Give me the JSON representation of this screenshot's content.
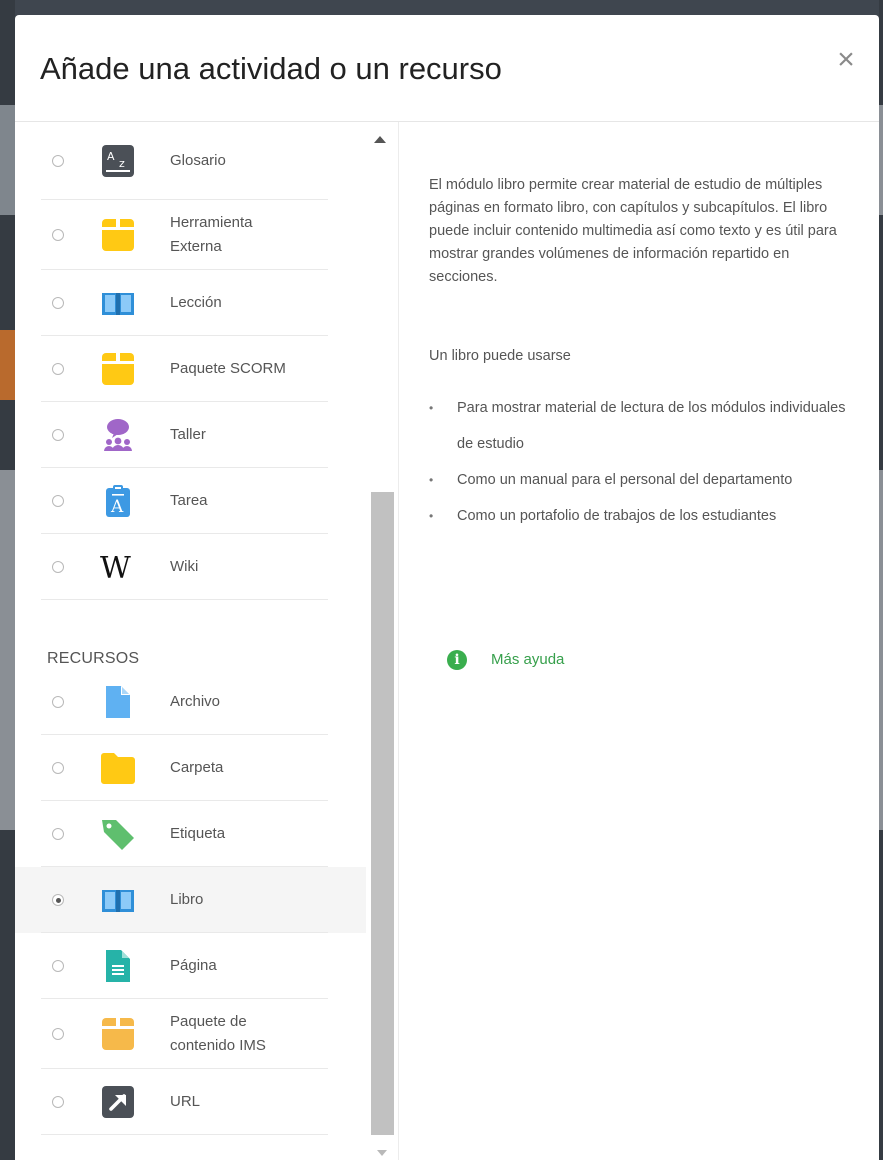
{
  "modal": {
    "title": "Añade una actividad o un recurso",
    "close_label": "×"
  },
  "activities": [
    {
      "label": "Glosario",
      "icon": "glossary-icon",
      "selected": false
    },
    {
      "label": "Herramienta\nExterna",
      "icon": "external-tool-icon",
      "selected": false
    },
    {
      "label": "Lección",
      "icon": "lesson-book-icon",
      "selected": false
    },
    {
      "label": "Paquete SCORM",
      "icon": "scorm-package-icon",
      "selected": false
    },
    {
      "label": "Taller",
      "icon": "workshop-icon",
      "selected": false
    },
    {
      "label": "Tarea",
      "icon": "assignment-icon",
      "selected": false
    },
    {
      "label": "Wiki",
      "icon": "wiki-icon",
      "selected": false
    }
  ],
  "resources_heading": "RECURSOS",
  "resources": [
    {
      "label": "Archivo",
      "icon": "file-icon",
      "selected": false
    },
    {
      "label": "Carpeta",
      "icon": "folder-icon",
      "selected": false
    },
    {
      "label": "Etiqueta",
      "icon": "tag-icon",
      "selected": false
    },
    {
      "label": "Libro",
      "icon": "book-icon",
      "selected": true
    },
    {
      "label": "Página",
      "icon": "page-icon",
      "selected": false
    },
    {
      "label": "Paquete de\ncontenido IMS",
      "icon": "ims-package-icon",
      "selected": false
    },
    {
      "label": "URL",
      "icon": "url-icon",
      "selected": false
    }
  ],
  "help": {
    "description": "El módulo libro permite crear material de estudio de múltiples páginas en formato libro, con capítulos y subcapítulos. El libro puede incluir contenido multimedia así como texto y es útil para mostrar grandes volúmenes de información repartido en secciones.",
    "subheading": "Un libro puede usarse",
    "uses": [
      "Para mostrar material de lectura de los módulos individuales de estudio",
      "Como un manual para el personal del departamento",
      "Como un portafolio de trabajos de los estudiantes"
    ],
    "more_help": "Más ayuda",
    "info_icon_glyph": "i"
  },
  "colors": {
    "selected_row": "#f5f5f5",
    "link_green": "#37a04c",
    "yellow": "#ffc914",
    "blue": "#5fb1f2"
  }
}
